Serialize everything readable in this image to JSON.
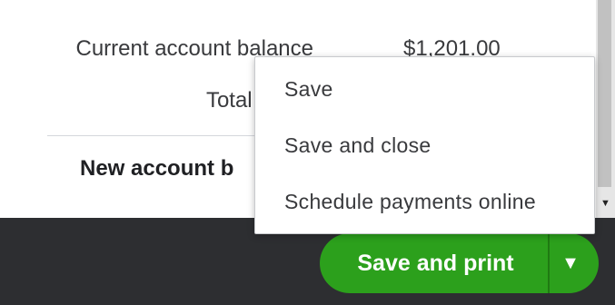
{
  "summary": {
    "current_balance_label": "Current account balance",
    "current_balance_value": "$1,201.00",
    "total_label": "Total pa",
    "new_balance_label": "New account b"
  },
  "footer": {
    "primary_button_label": "Save and print"
  },
  "menu": {
    "items": [
      "Save",
      "Save and close",
      "Schedule payments online"
    ]
  },
  "icons": {
    "dropdown_caret": "caret-down-icon",
    "scroll_down": "scroll-down-arrow-icon"
  },
  "colors": {
    "primary_green": "#2ca01c",
    "footer_bg": "#2d2e31"
  }
}
